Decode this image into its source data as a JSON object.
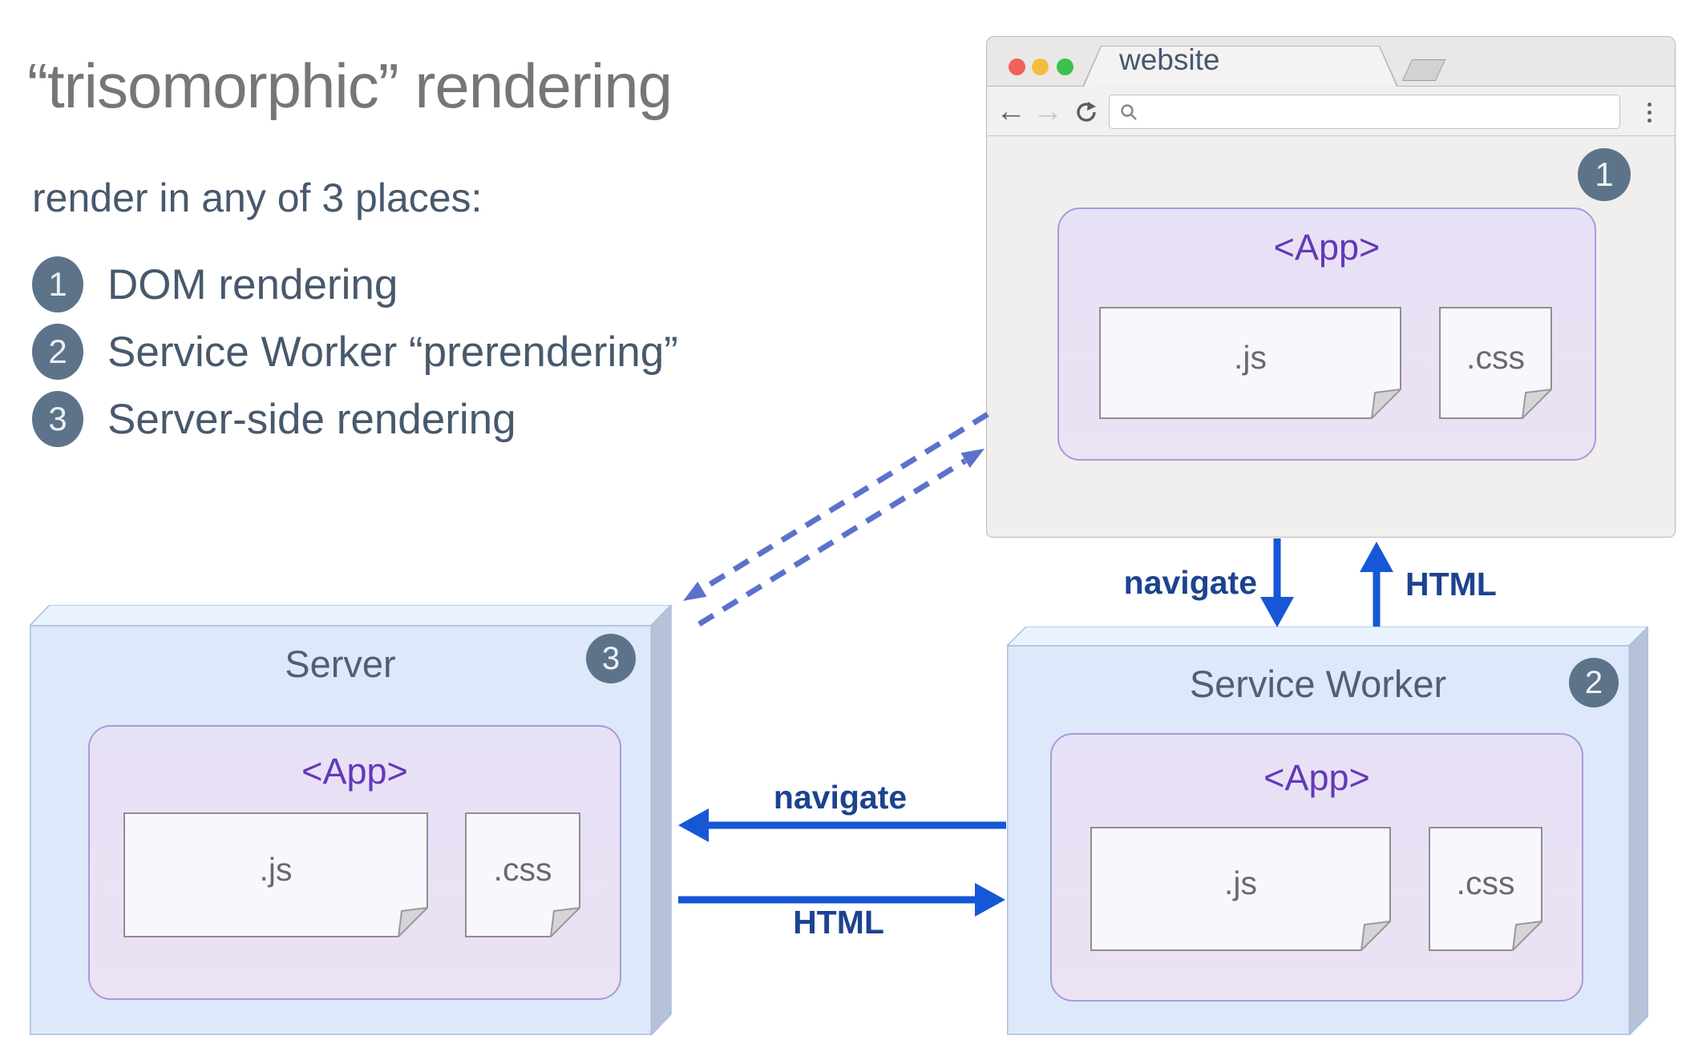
{
  "left_panel": {
    "title": "“trisomorphic” rendering",
    "subtitle": "render in any of 3 places:",
    "items": [
      {
        "num": "1",
        "label": "DOM rendering"
      },
      {
        "num": "2",
        "label": "Service Worker “prerendering”"
      },
      {
        "num": "3",
        "label": "Server-side rendering"
      }
    ]
  },
  "browser": {
    "tab_title": "website",
    "url_value": "",
    "badge": "1",
    "app": {
      "title": "<App>",
      "files": [
        {
          "label": ".js"
        },
        {
          "label": ".css"
        }
      ]
    }
  },
  "server": {
    "title": "Server",
    "badge": "3",
    "app": {
      "title": "<App>",
      "files": [
        {
          "label": ".js"
        },
        {
          "label": ".css"
        }
      ]
    }
  },
  "service_worker": {
    "title": "Service Worker",
    "badge": "2",
    "app": {
      "title": "<App>",
      "files": [
        {
          "label": ".js"
        },
        {
          "label": ".css"
        }
      ]
    }
  },
  "arrows": {
    "navigate_vertical": "navigate",
    "html_vertical": "HTML",
    "navigate_horizontal": "navigate",
    "html_horizontal": "HTML"
  },
  "colors": {
    "arrow_blue": "#1657d6",
    "label_navy": "#1c4390",
    "dashed_blue": "#5b72cc",
    "badge_slate": "#5d7389",
    "app_purple_text": "#6438b8",
    "app_fill": "#e7e1f7",
    "app_border": "#a79bd9",
    "box_fill": "#dde9fa",
    "box_top_fill": "#e9f2fd",
    "box_side_fill": "#b6c2d7",
    "box_border": "#a9bedd",
    "title_gray": "#767676",
    "slate_text": "#48596d",
    "traffic_red": "#f0625a",
    "traffic_yellow": "#f6bc42",
    "traffic_green": "#3ac24b"
  }
}
